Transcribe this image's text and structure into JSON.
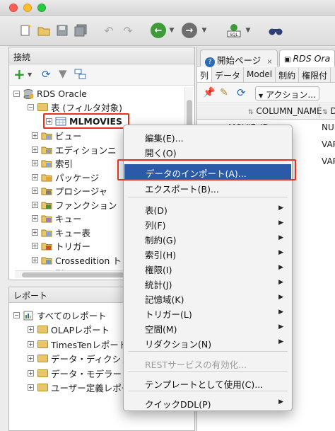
{
  "toolbar": {
    "buttons": [
      "new-file",
      "open-folder",
      "save",
      "save-all",
      "undo",
      "redo",
      "back",
      "forward",
      "sql-worksheet",
      "find"
    ]
  },
  "connections_panel": {
    "title": "接続",
    "tree": {
      "root": "RDS Oracle",
      "tables_folder": "表 (フィルタ対象)",
      "selected_table": "MLMOVIES",
      "items": [
        "ビュー",
        "エディションニ",
        "索引",
        "パッケージ",
        "プロシージャ",
        "ファンクション",
        "キュー",
        "キュー表",
        "トリガー",
        "Crossedition トリ",
        "型"
      ]
    }
  },
  "reports_panel": {
    "title": "レポート",
    "root": "すべてのレポート",
    "items": [
      "OLAPレポート",
      "TimesTenレポート",
      "データ・ディクショ",
      "データ・モデラー・",
      "ユーザー定義レポー"
    ]
  },
  "editor": {
    "tabs": [
      "開始ページ",
      "RDS Ora"
    ],
    "sub_tabs": [
      "列",
      "データ",
      "Model",
      "制約",
      "権限付"
    ],
    "actions_label": "アクション...",
    "column_header": "COLUMN_NAME",
    "column_header_2": "D",
    "rows": [
      {
        "name": "MOVIE_ID",
        "type": "NUM"
      },
      {
        "name": "",
        "type": "VAR"
      },
      {
        "name": "",
        "type": "VAR"
      }
    ]
  },
  "context_menu": {
    "items": [
      {
        "label": "編集(E)...",
        "submenu": false,
        "disabled": false
      },
      {
        "label": "開く(O)",
        "submenu": false,
        "disabled": false
      },
      {
        "label": "データのインポート(A)...",
        "submenu": false,
        "disabled": false,
        "highlighted": true
      },
      {
        "label": "エクスポート(B)...",
        "submenu": false,
        "disabled": false
      },
      {
        "label": "表(D)",
        "submenu": true,
        "disabled": false
      },
      {
        "label": "列(F)",
        "submenu": true,
        "disabled": false
      },
      {
        "label": "制約(G)",
        "submenu": true,
        "disabled": false
      },
      {
        "label": "索引(H)",
        "submenu": true,
        "disabled": false
      },
      {
        "label": "権限(I)",
        "submenu": true,
        "disabled": false
      },
      {
        "label": "統計(J)",
        "submenu": true,
        "disabled": false
      },
      {
        "label": "記憶域(K)",
        "submenu": true,
        "disabled": false
      },
      {
        "label": "トリガー(L)",
        "submenu": true,
        "disabled": false
      },
      {
        "label": "空間(M)",
        "submenu": true,
        "disabled": false
      },
      {
        "label": "リダクション(N)",
        "submenu": true,
        "disabled": false
      },
      {
        "label": "RESTサービスの有効化...",
        "submenu": false,
        "disabled": true
      },
      {
        "label": "テンプレートとして使用(C)...",
        "submenu": false,
        "disabled": false
      },
      {
        "label": "クイックDDL(P)",
        "submenu": true,
        "disabled": false
      }
    ]
  },
  "colors": {
    "menu_highlight": "#2a5aa8",
    "callout_red": "#e5321f",
    "navigate_green": "#3f9b3a",
    "navigate_gray": "#6e6e6e"
  }
}
